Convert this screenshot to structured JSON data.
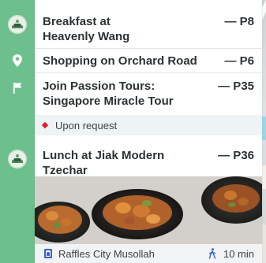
{
  "itinerary": [
    {
      "title_line1": "Breakfast at",
      "title_line2": "Heavenly Wang",
      "page": "— P8",
      "marker": "heavenly-wang-logo-icon"
    },
    {
      "title_line1": "Shopping on Orchard Road",
      "title_line2": "",
      "page": "— P6",
      "marker": "location-pin-icon"
    },
    {
      "title_line1": "Join Passion Tours:",
      "title_line2": "Singapore Miracle Tour",
      "page": "— P35",
      "marker": "flag-icon"
    },
    {
      "title_line1": "Lunch at Jiak Modern",
      "title_line2": "Tzechar",
      "page": "— P36",
      "marker": "restaurant-logo-icon"
    }
  ],
  "note": {
    "text": "Upon request",
    "color": "#e0202e"
  },
  "footer": {
    "place": "Raffles City Musollah",
    "walk_time": "10 min",
    "place_icon": "mosque-icon",
    "walk_icon": "walking-person-icon"
  },
  "colors": {
    "rail": "#6dbf8e",
    "accent_blue": "#3a62c9",
    "text": "#2b3335"
  }
}
